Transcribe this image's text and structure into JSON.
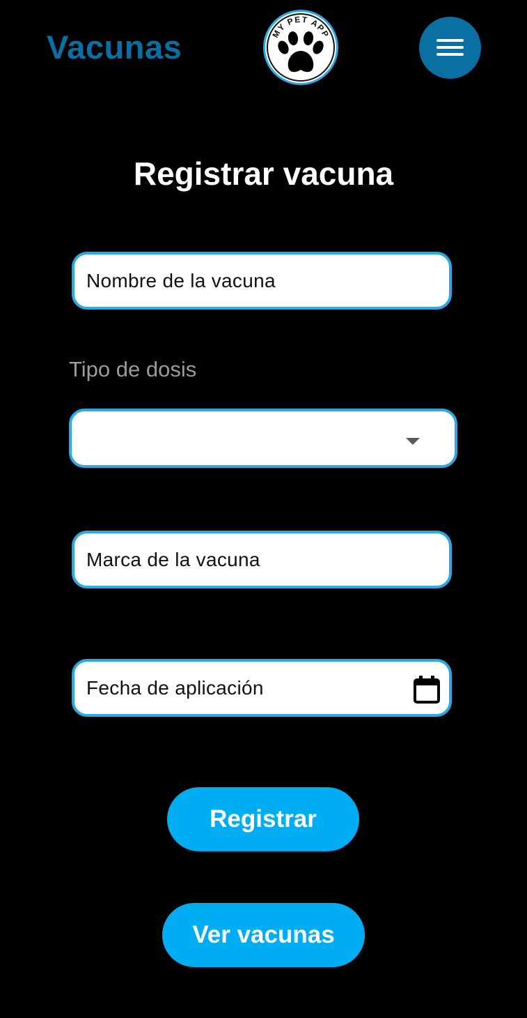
{
  "header": {
    "title": "Vacunas",
    "logo_text": "MY PET APP",
    "menu_icon": "hamburger-menu-icon"
  },
  "form": {
    "title": "Registrar vacuna",
    "vaccine_name": {
      "placeholder": "Nombre de la vacuna",
      "value": ""
    },
    "dose_type": {
      "label": "Tipo de dosis",
      "selected": "",
      "icon": "dropdown-arrow-icon"
    },
    "vaccine_brand": {
      "placeholder": "Marca de la vacuna",
      "value": ""
    },
    "application_date": {
      "placeholder": "Fecha de aplicación",
      "value": "",
      "icon": "calendar-icon"
    }
  },
  "actions": {
    "register_label": "Registrar",
    "view_label": "Ver vacunas"
  },
  "colors": {
    "background": "#000000",
    "brand_blue": "#0a6fa3",
    "accent_blue": "#00adf2",
    "field_border": "#29a9e6",
    "field_bg": "#ffffff",
    "label_gray": "#9b9b9b"
  }
}
